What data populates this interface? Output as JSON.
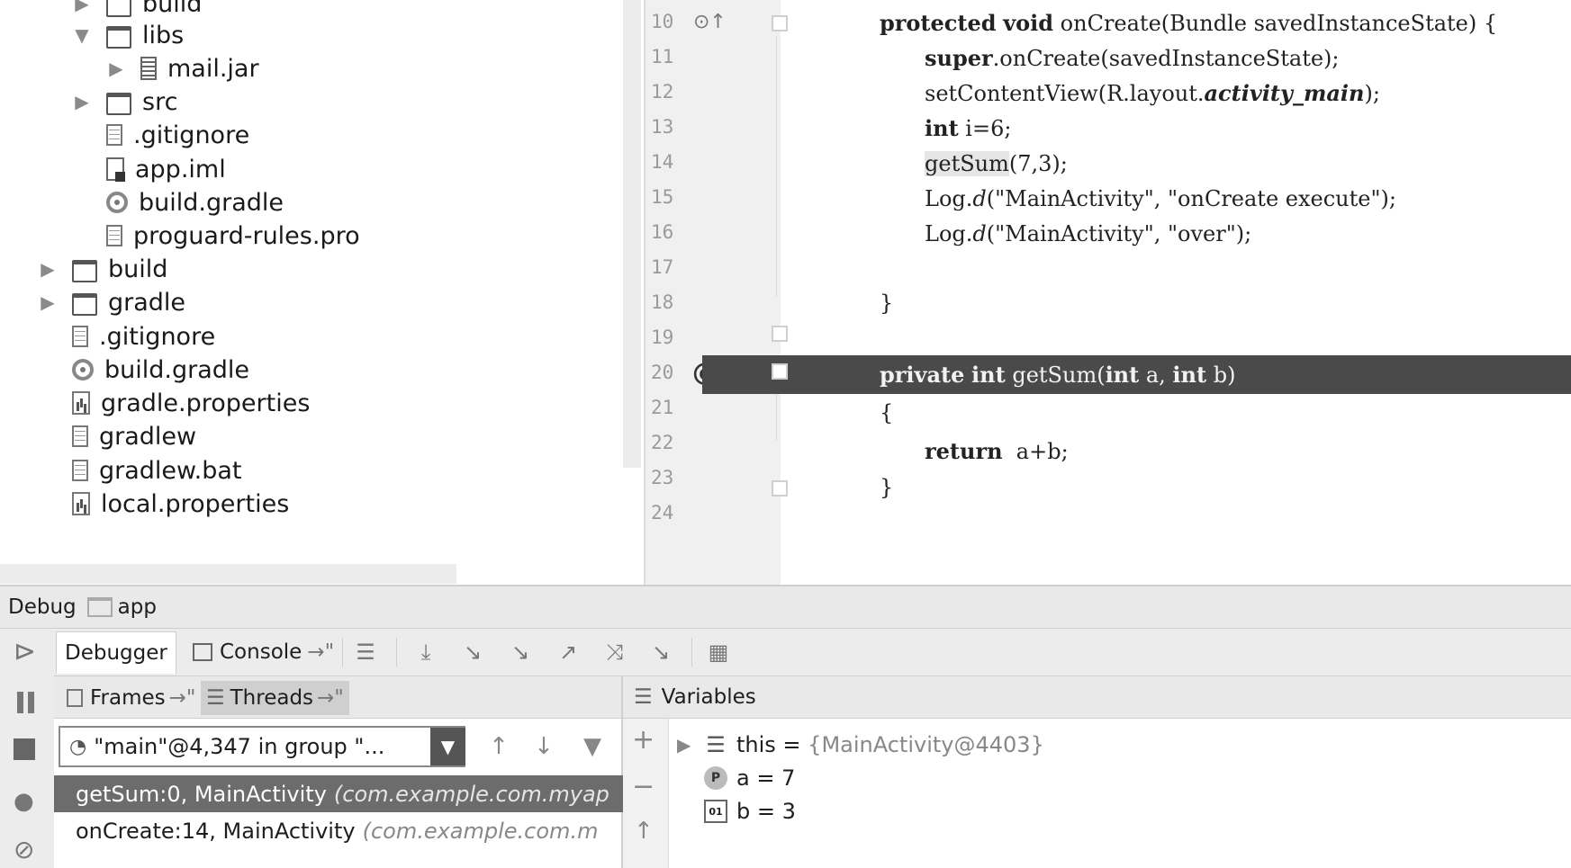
{
  "project_tree": {
    "items": [
      {
        "label": "build",
        "type": "folder",
        "expander": "collapsed"
      },
      {
        "label": "libs",
        "type": "folder",
        "expander": "expanded"
      },
      {
        "label": "mail.jar",
        "type": "jar",
        "expander": "collapsed"
      },
      {
        "label": "src",
        "type": "folder",
        "expander": "collapsed"
      },
      {
        "label": ".gitignore",
        "type": "file",
        "expander": "none"
      },
      {
        "label": "app.iml",
        "type": "iml",
        "expander": "none"
      },
      {
        "label": "build.gradle",
        "type": "gradle",
        "expander": "none"
      },
      {
        "label": "proguard-rules.pro",
        "type": "file",
        "expander": "none"
      },
      {
        "label": "build",
        "type": "folder",
        "expander": "collapsed"
      },
      {
        "label": "gradle",
        "type": "folder",
        "expander": "collapsed"
      },
      {
        "label": ".gitignore",
        "type": "file",
        "expander": "none"
      },
      {
        "label": "build.gradle",
        "type": "gradle",
        "expander": "none"
      },
      {
        "label": "gradle.properties",
        "type": "props",
        "expander": "none"
      },
      {
        "label": "gradlew",
        "type": "file",
        "expander": "none"
      },
      {
        "label": "gradlew.bat",
        "type": "file",
        "expander": "none"
      },
      {
        "label": "local.properties",
        "type": "props",
        "expander": "none"
      }
    ]
  },
  "editor": {
    "line_numbers": [
      "10",
      "11",
      "12",
      "13",
      "14",
      "15",
      "16",
      "17",
      "18",
      "19",
      "20",
      "21",
      "22",
      "23",
      "24"
    ],
    "lines": {
      "l10": {
        "kw1": "protected",
        "kw2": "void",
        "rest": " onCreate(Bundle savedInstanceState) {"
      },
      "l11": {
        "kw": "super",
        "rest": ".onCreate(savedInstanceState);"
      },
      "l12": {
        "pre": "setContentView(R.layout.",
        "ital": "activity_main",
        "post": ");"
      },
      "l13": {
        "kw": "int",
        "rest": " i=6;"
      },
      "l14": {
        "hl": "getSum",
        "rest": "(7,3);"
      },
      "l15": {
        "pre": "Log.",
        "m": "d",
        "post": "(\"MainActivity\", \"onCreate execute\");"
      },
      "l16": {
        "pre": "Log.",
        "m": "d",
        "post": "(\"MainActivity\", \"over\");"
      },
      "l18": {
        "text": "}"
      },
      "l19": {
        "kw1": "private",
        "kw2": "int",
        "mid": " getSum(",
        "kw3": "int",
        "mid2": " a, ",
        "kw4": "int",
        "post": " b)"
      },
      "l20": {
        "text": "{"
      },
      "l21": {
        "kw": "return",
        "rest": "  a+b;"
      },
      "l22": {
        "text": "}"
      }
    },
    "breakpoint_line": "19"
  },
  "debug": {
    "title": "Debug",
    "config": "app",
    "tabs": {
      "debugger": "Debugger",
      "console": "Console"
    },
    "frames_tab": "Frames",
    "threads_tab": "Threads",
    "thread_selector": "\"main\"@4,347 in group \"...",
    "frames": [
      {
        "method": "getSum:0, MainActivity",
        "pkg": "(com.example.com.myap",
        "selected": true
      },
      {
        "method": "onCreate:14, MainActivity",
        "pkg": "(com.example.com.m",
        "selected": false
      }
    ],
    "variables_title": "Variables",
    "variables": [
      {
        "name": "this",
        "eq": " = ",
        "value": "{MainActivity@4403}",
        "icon": "fields-icon"
      },
      {
        "name": "a",
        "eq": " = ",
        "value": "7",
        "icon": "parameter-icon"
      },
      {
        "name": "b",
        "eq": " = ",
        "value": "3",
        "icon": "local-variable-icon"
      }
    ]
  }
}
